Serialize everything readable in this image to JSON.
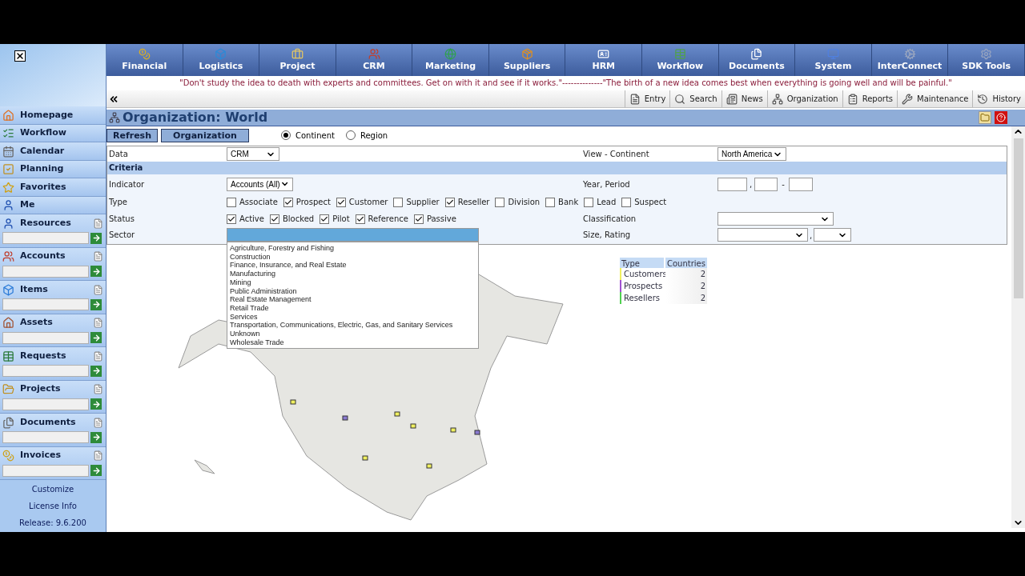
{
  "nav_tabs": [
    {
      "label": "Financial"
    },
    {
      "label": "Logistics"
    },
    {
      "label": "Project"
    },
    {
      "label": "CRM"
    },
    {
      "label": "Marketing"
    },
    {
      "label": "Suppliers"
    },
    {
      "label": "HRM"
    },
    {
      "label": "Workflow"
    },
    {
      "label": "Documents"
    },
    {
      "label": "System"
    },
    {
      "label": "InterConnect"
    },
    {
      "label": "SDK Tools"
    }
  ],
  "quote": "\"Don't study the idea to death with experts and committees. Get on with it and see if it works.\"--------------\"The birth of a new idea comes best when everything is going well and will be painful.\"",
  "toolbar": [
    {
      "label": "Entry"
    },
    {
      "label": "Search"
    },
    {
      "label": "News"
    },
    {
      "label": "Organization"
    },
    {
      "label": "Reports"
    },
    {
      "label": "Maintenance"
    },
    {
      "label": "History"
    }
  ],
  "sidebar": {
    "items": [
      {
        "label": "Homepage",
        "kind": "link"
      },
      {
        "label": "Workflow",
        "kind": "link"
      },
      {
        "label": "Calendar",
        "kind": "link"
      },
      {
        "label": "Planning",
        "kind": "link"
      },
      {
        "label": "Favorites",
        "kind": "link"
      },
      {
        "label": "Me",
        "kind": "link"
      },
      {
        "label": "Resources",
        "kind": "search"
      },
      {
        "label": "Accounts",
        "kind": "search"
      },
      {
        "label": "Items",
        "kind": "search"
      },
      {
        "label": "Assets",
        "kind": "search"
      },
      {
        "label": "Requests",
        "kind": "search"
      },
      {
        "label": "Projects",
        "kind": "search"
      },
      {
        "label": "Documents",
        "kind": "search"
      },
      {
        "label": "Invoices",
        "kind": "search"
      }
    ],
    "footer": [
      "Customize",
      "License Info",
      "Release: 9.6.200"
    ]
  },
  "page": {
    "title": "Organization: World",
    "buttons": [
      "Refresh",
      "Organization"
    ],
    "scope": [
      {
        "label": "Continent",
        "selected": true
      },
      {
        "label": "Region",
        "selected": false
      }
    ]
  },
  "form": {
    "data": {
      "label": "Data",
      "value": "CRM"
    },
    "view": {
      "label": "View - Continent",
      "value": "North America"
    },
    "criteria": "Criteria",
    "indicator": {
      "label": "Indicator",
      "value": "Accounts (All)"
    },
    "year": {
      "label": "Year, Period",
      "separators": [
        ",",
        "-"
      ]
    },
    "type": {
      "label": "Type",
      "options": [
        {
          "label": "Associate",
          "checked": false
        },
        {
          "label": "Prospect",
          "checked": true
        },
        {
          "label": "Customer",
          "checked": true
        },
        {
          "label": "Supplier",
          "checked": false
        },
        {
          "label": "Reseller",
          "checked": true
        },
        {
          "label": "Division",
          "checked": false
        },
        {
          "label": "Bank",
          "checked": false
        },
        {
          "label": "Lead",
          "checked": false
        },
        {
          "label": "Suspect",
          "checked": false
        }
      ]
    },
    "status": {
      "label": "Status",
      "options": [
        {
          "label": "Active",
          "checked": true
        },
        {
          "label": "Blocked",
          "checked": true
        },
        {
          "label": "Pilot",
          "checked": true
        },
        {
          "label": "Reference",
          "checked": true
        },
        {
          "label": "Passive",
          "checked": true
        }
      ]
    },
    "classification": {
      "label": "Classification"
    },
    "sector": {
      "label": "Sector",
      "expanded": true,
      "options": [
        "Agriculture, Forestry and Fishing",
        "Construction",
        "Finance, Insurance, and Real Estate",
        "Manufacturing",
        "Mining",
        "Public Administration",
        "Real Estate Management",
        "Retail Trade",
        "Services",
        "Transportation, Communications, Electric, Gas, and Sanitary Services",
        "Unknown",
        "Wholesale Trade"
      ]
    },
    "size": {
      "label": "Size, Rating",
      "separator": ","
    }
  },
  "legend": {
    "columns": [
      "Type",
      "Countries"
    ],
    "rows": [
      {
        "type": "Customers",
        "count": "2",
        "color": "#f0f060"
      },
      {
        "type": "Prospects",
        "count": "2",
        "color": "#a050d0"
      },
      {
        "type": "Resellers",
        "count": "2",
        "color": "#50d050"
      }
    ]
  }
}
